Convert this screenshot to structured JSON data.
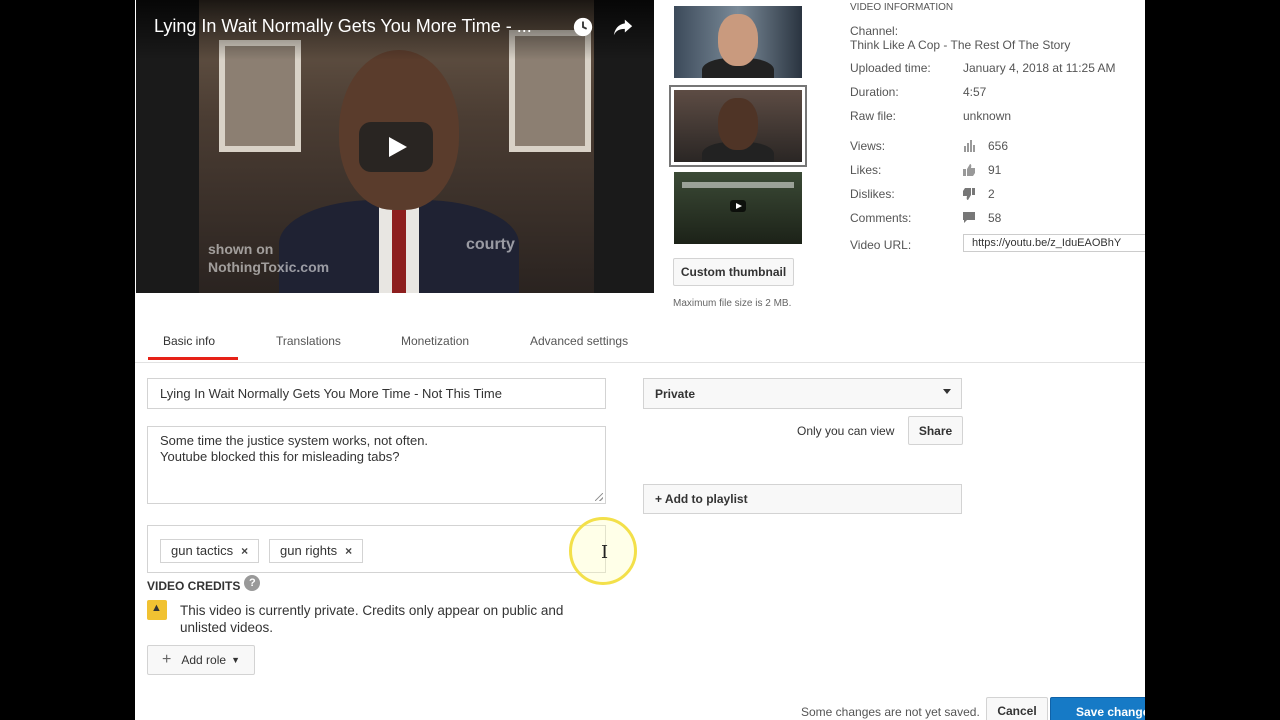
{
  "player": {
    "title": "Lying In Wait Normally Gets You More Time - ...",
    "watermark_line1": "shown on",
    "watermark_line2": "NothingToxic.com",
    "watermark_right": "courty"
  },
  "thumbnails": {
    "custom_button": "Custom thumbnail",
    "max_file": "Maximum file size is 2 MB."
  },
  "info": {
    "header": "VIDEO INFORMATION",
    "channel_label": "Channel:",
    "channel_value": "Think Like A Cop - The Rest Of The Story",
    "uploaded_label": "Uploaded time:",
    "uploaded_value": "January 4, 2018 at 11:25 AM",
    "duration_label": "Duration:",
    "duration_value": "4:57",
    "raw_label": "Raw file:",
    "raw_value": "unknown",
    "views_label": "Views:",
    "views_value": "656",
    "likes_label": "Likes:",
    "likes_value": "91",
    "dislikes_label": "Dislikes:",
    "dislikes_value": "2",
    "comments_label": "Comments:",
    "comments_value": "58",
    "url_label": "Video URL:",
    "url_value": "https://youtu.be/z_IduEAOBhY"
  },
  "tabs": [
    "Basic info",
    "Translations",
    "Monetization",
    "Advanced settings"
  ],
  "form": {
    "title_value": "Lying In Wait Normally Gets You More Time - Not This Time",
    "description_line1": "Some time the justice system works, not often.",
    "description_line2": "Youtube blocked this for misleading tabs?",
    "tags": [
      "gun tactics",
      "gun rights"
    ],
    "tag_remove": "×",
    "credits_header": "VIDEO CREDITS",
    "help": "?",
    "credits_warning": "This video is currently private. Credits only appear on public and unlisted videos.",
    "add_role": "Add role",
    "privacy_value": "Private",
    "only_you": "Only you can view",
    "share": "Share",
    "add_playlist": "+ Add to playlist"
  },
  "footer": {
    "unsaved": "Some changes are not yet saved.",
    "cancel": "Cancel",
    "save": "Save changes"
  },
  "colors": {
    "accent_red": "#e62117",
    "save_blue": "#167ac6",
    "warning_yellow": "#f1c232"
  }
}
